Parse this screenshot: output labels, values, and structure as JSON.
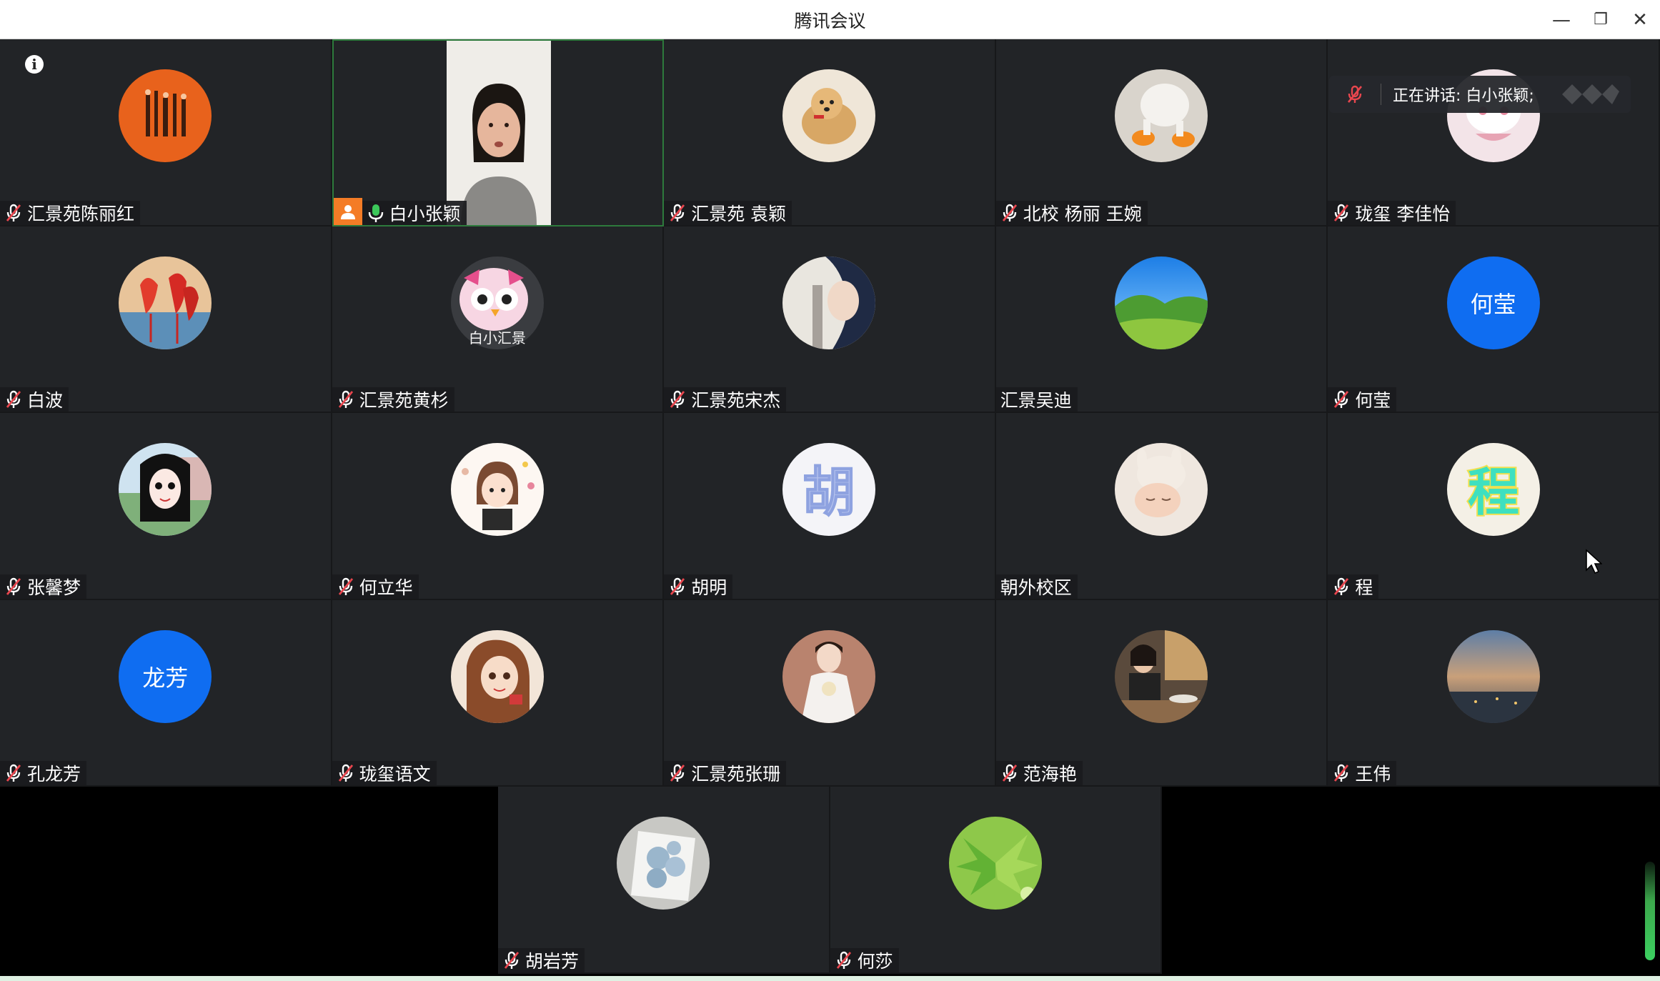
{
  "window": {
    "title": "腾讯会议",
    "minimize_icon": "minimize-icon",
    "restore_icon": "restore-icon",
    "close_icon": "close-icon"
  },
  "speaking": {
    "text": "正在讲话: 白小张颖;"
  },
  "participants": [
    {
      "name": "汇景苑陈丽红",
      "muted": true,
      "avatar": "orange-abstract"
    },
    {
      "name": "白小张颖",
      "muted": false,
      "avatar": "video",
      "host": true
    },
    {
      "name": "汇景苑 袁颖",
      "muted": true,
      "avatar": "pomeranian"
    },
    {
      "name": "北校 杨丽 王婉",
      "muted": true,
      "avatar": "duck-toy"
    },
    {
      "name": "珑玺 李佳怡",
      "muted": true,
      "avatar": "pink-cartoon"
    },
    {
      "name": "白波",
      "muted": true,
      "avatar": "flamingos"
    },
    {
      "name": "汇景苑黄杉",
      "muted": true,
      "avatar": "owl",
      "avatar_caption": "白小汇景"
    },
    {
      "name": "汇景苑宋杰",
      "muted": true,
      "avatar": "portrait"
    },
    {
      "name": "汇景吴迪",
      "muted": null,
      "avatar": "green-hills"
    },
    {
      "name": "何莹",
      "muted": true,
      "avatar_text": "何莹"
    },
    {
      "name": "张馨梦",
      "muted": true,
      "avatar": "anime-girl"
    },
    {
      "name": "何立华",
      "muted": true,
      "avatar": "cartoon-girl"
    },
    {
      "name": "胡明",
      "muted": true,
      "avatar": "hu-glyph",
      "avatar_glyph": "胡"
    },
    {
      "name": "朝外校区",
      "muted": null,
      "avatar": "baby"
    },
    {
      "name": "程",
      "muted": true,
      "avatar": "cheng-glyph",
      "avatar_glyph": "程"
    },
    {
      "name": "孔龙芳",
      "muted": true,
      "avatar_text": "龙芳"
    },
    {
      "name": "珑玺语文",
      "muted": true,
      "avatar": "illustrated-girl"
    },
    {
      "name": "汇景苑张珊",
      "muted": true,
      "avatar": "bride"
    },
    {
      "name": "范海艳",
      "muted": true,
      "avatar": "cafe-photo"
    },
    {
      "name": "王伟",
      "muted": true,
      "avatar": "sunset-sky"
    },
    {
      "name": "胡岩芳",
      "muted": true,
      "avatar": "blue-roses"
    },
    {
      "name": "何莎",
      "muted": true,
      "avatar": "green-leaves"
    }
  ],
  "colors": {
    "muted_icon": "#e8464e",
    "active_mic": "#3cc85a",
    "text_avatar": "#0f6df1",
    "host_badge": "#f47c26"
  }
}
